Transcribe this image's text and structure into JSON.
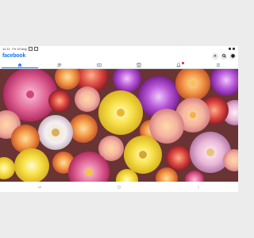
{
  "status": {
    "time": "11:11",
    "date": "Fri 19 Aug"
  },
  "header": {
    "logo": "facebook",
    "add_label": "+",
    "search_icon": "search-icon",
    "messenger_icon": "messenger-icon"
  },
  "tabs": [
    {
      "id": "home",
      "icon": "home-icon",
      "active": true
    },
    {
      "id": "friends",
      "icon": "friends-icon",
      "active": false
    },
    {
      "id": "watch",
      "icon": "video-icon",
      "active": false
    },
    {
      "id": "marketplace",
      "icon": "marketplace-icon",
      "active": false
    },
    {
      "id": "notifications",
      "icon": "bell-icon",
      "active": false,
      "badge": true
    },
    {
      "id": "menu",
      "icon": "menu-icon",
      "active": false
    }
  ],
  "photo": {
    "subject": "dahlia-flowers",
    "accent": "#1877f2"
  },
  "navbar": {
    "icons": [
      "recents-icon",
      "home-button-icon",
      "back-icon"
    ]
  }
}
